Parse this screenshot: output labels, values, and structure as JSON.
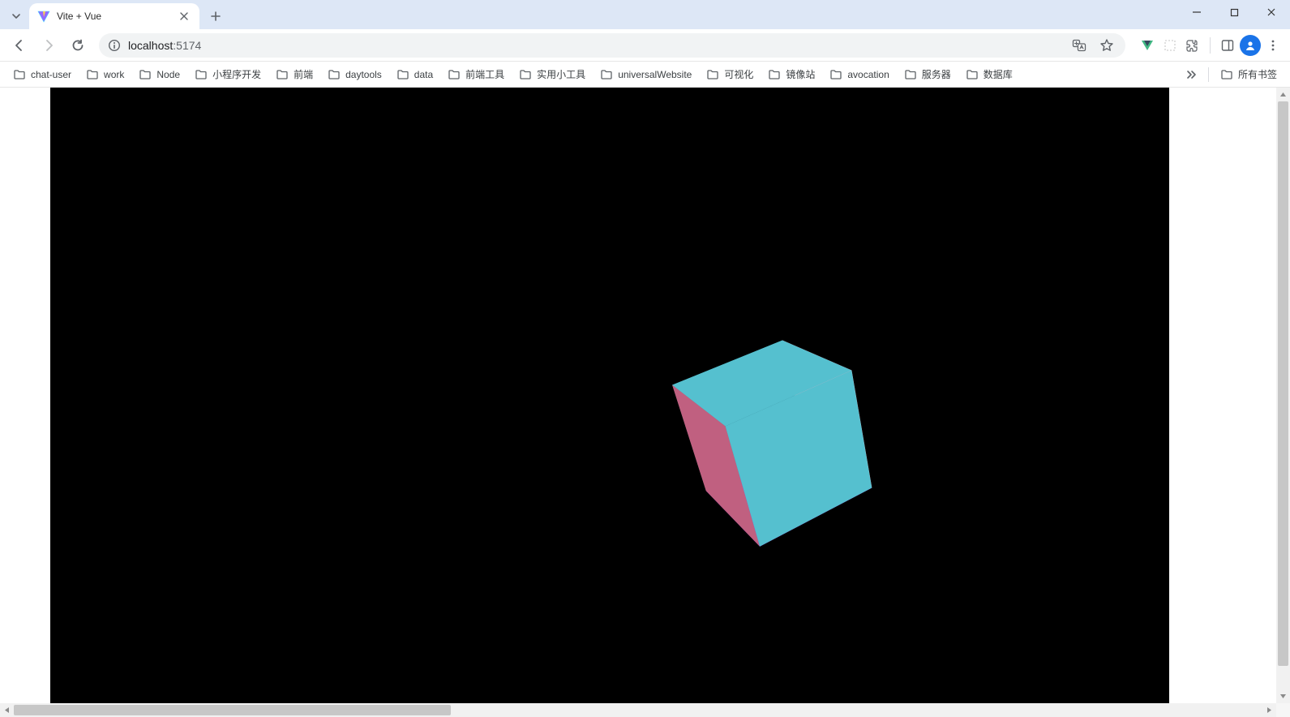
{
  "window": {
    "tab_title": "Vite + Vue"
  },
  "address": {
    "host": "localhost",
    "port": ":5174"
  },
  "bookmarks": {
    "items": [
      "chat-user",
      "work",
      "Node",
      "小程序开发",
      "前端",
      "daytools",
      "data",
      "前端工具",
      "实用小工具",
      "universalWebsite",
      "可视化",
      "镜像站",
      "avocation",
      "服务器",
      "数据库"
    ],
    "all_label": "所有书签"
  },
  "cube": {
    "colors": {
      "top": "#55c0cf",
      "right": "#f5a9c0",
      "bottom": "#8916c9"
    }
  }
}
